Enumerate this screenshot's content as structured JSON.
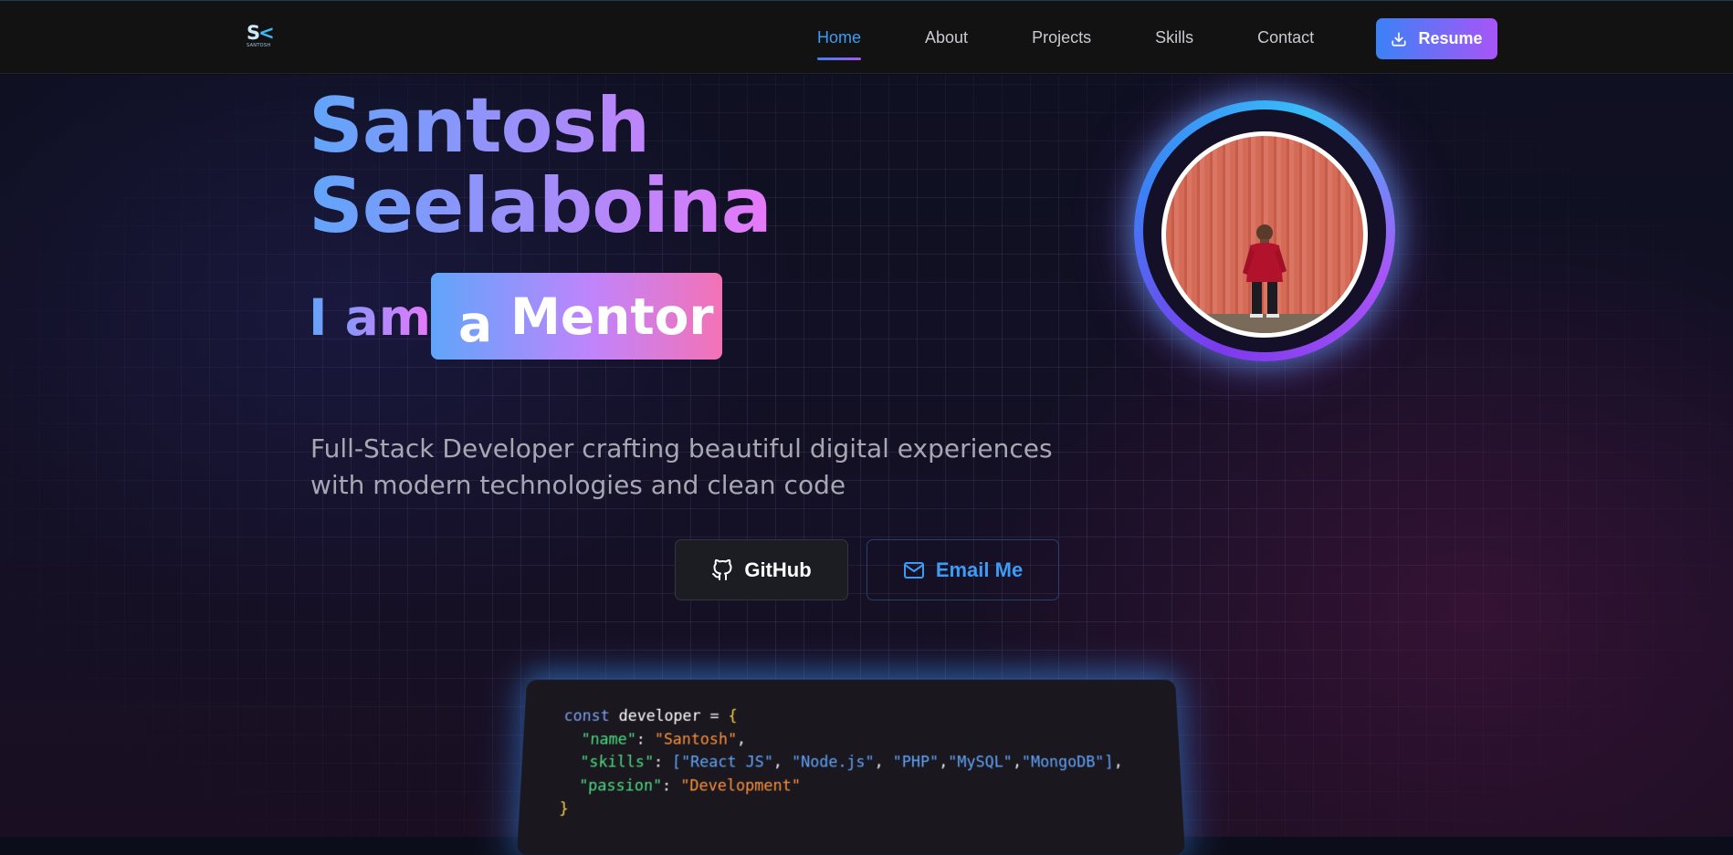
{
  "nav": {
    "logo_mark": "SK",
    "logo_sub": "SANTOSH",
    "links": [
      {
        "label": "Home",
        "active": true
      },
      {
        "label": "About",
        "active": false
      },
      {
        "label": "Projects",
        "active": false
      },
      {
        "label": "Skills",
        "active": false
      },
      {
        "label": "Contact",
        "active": false
      }
    ],
    "resume_label": "Resume",
    "resume_icon": "download-icon"
  },
  "hero": {
    "first_name": "Santosh",
    "last_name": "Seelaboina",
    "role_prefix": "I am",
    "role_article": "a",
    "role_word": "Mentor",
    "tagline_line1": "Full-Stack Developer crafting beautiful digital experiences",
    "tagline_line2": "with modern technologies and clean code",
    "github_label": "GitHub",
    "github_icon": "github-icon",
    "email_label": "Email Me",
    "email_icon": "mail-icon"
  },
  "code": {
    "keyword": "const",
    "identifier": "developer",
    "name_key": "\"name\"",
    "name_value": "\"Santosh\"",
    "skills_key": "\"skills\"",
    "skills": [
      "\"React JS\"",
      "\"Node.js\"",
      "\"PHP\"",
      "\"MySQL\"",
      "\"MongoDB\""
    ],
    "passion_key": "\"passion\"",
    "passion_value": "\"Development\""
  },
  "colors": {
    "accent_blue": "#3b82f6",
    "accent_purple": "#a855f7",
    "accent_pink": "#f472b6",
    "nav_bg": "#121212"
  }
}
